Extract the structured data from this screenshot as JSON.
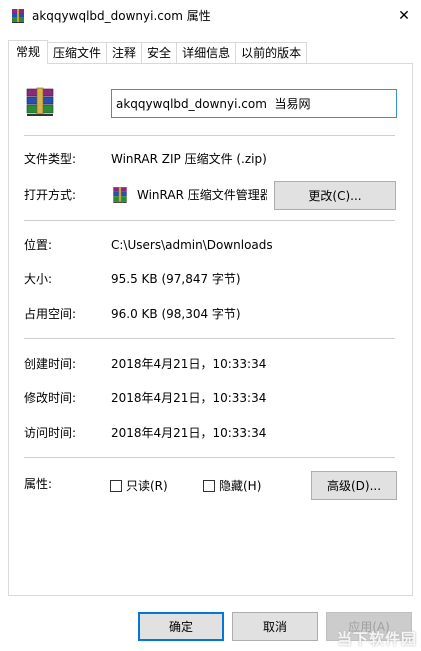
{
  "window": {
    "title": "akqqywqlbd_downyi.com 属性",
    "close_symbol": "✕"
  },
  "tabs": [
    {
      "label": "常规",
      "active": true
    },
    {
      "label": "压缩文件",
      "active": false
    },
    {
      "label": "注释",
      "active": false
    },
    {
      "label": "安全",
      "active": false
    },
    {
      "label": "详细信息",
      "active": false
    },
    {
      "label": "以前的版本",
      "active": false
    }
  ],
  "general": {
    "file_name": "akqqywqlbd_downyi.com  当易网",
    "file_type_label": "文件类型:",
    "file_type_value": "WinRAR ZIP 压缩文件 (.zip)",
    "open_with_label": "打开方式:",
    "open_with_value": "WinRAR 压缩文件管理器",
    "change_button": "更改(C)...",
    "location_label": "位置:",
    "location_value": "C:\\Users\\admin\\Downloads",
    "size_label": "大小:",
    "size_value": "95.5 KB (97,847 字节)",
    "size_on_disk_label": "占用空间:",
    "size_on_disk_value": "96.0 KB (98,304 字节)",
    "created_label": "创建时间:",
    "created_value": "2018年4月21日，10:33:34",
    "modified_label": "修改时间:",
    "modified_value": "2018年4月21日，10:33:34",
    "accessed_label": "访问时间:",
    "accessed_value": "2018年4月21日，10:33:34",
    "attributes_label": "属性:",
    "readonly_label": "只读(R)",
    "hidden_label": "隐藏(H)",
    "advanced_button": "高级(D)..."
  },
  "footer": {
    "ok": "确定",
    "cancel": "取消",
    "apply": "应用(A)",
    "watermark": "当下软件园"
  },
  "icons": {
    "title": "winrar-archive-icon",
    "large": "winrar-archive-icon",
    "open_with": "winrar-app-icon",
    "close": "close-icon"
  },
  "colors": {
    "accent": "#0078d7",
    "input_border": "#3b8ed8",
    "button_face": "#e1e1e1",
    "separator": "#cfcfcf"
  }
}
